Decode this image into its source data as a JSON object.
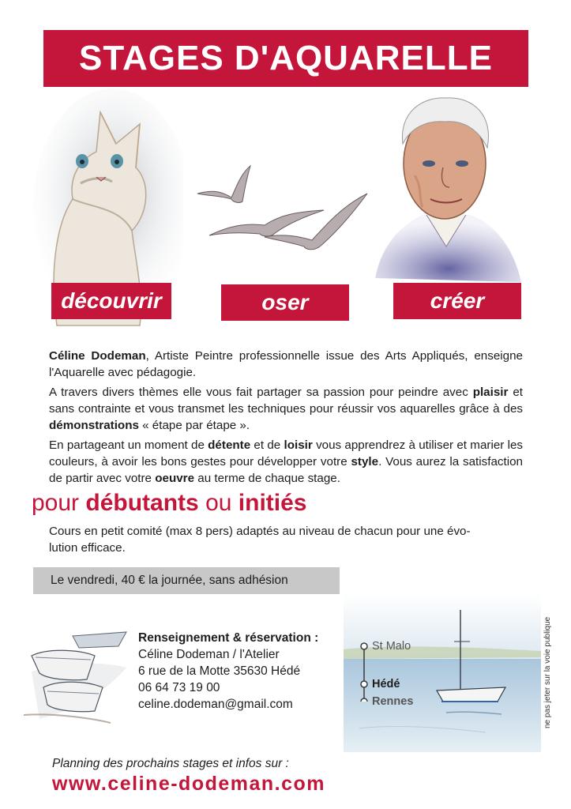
{
  "colors": {
    "brand_red": "#c4153a",
    "price_bar": "#c8c8c8"
  },
  "banner": {
    "title": "STAGES D'AQUARELLE"
  },
  "illustrations": {
    "cat": "cat-watercolor",
    "birds": "seagulls-watercolor",
    "portrait": "man-portrait-watercolor",
    "boats": "rowboats-watercolor",
    "harbor": "sailboat-harbor-watercolor"
  },
  "tags": {
    "discover": "découvrir",
    "dare": "oser",
    "create": "créer"
  },
  "intro": {
    "p1": [
      {
        "t": "Céline Dodeman",
        "b": true
      },
      {
        "t": ", Artiste Peintre professionnelle issue des Arts Appliqués, enseigne l'Aquarelle avec pédagogie.",
        "b": false
      }
    ],
    "p2": [
      {
        "t": "A travers divers thèmes elle vous fait partager sa passion pour peindre avec ",
        "b": false
      },
      {
        "t": "plaisir",
        "b": true
      },
      {
        "t": " et sans contrainte et vous transmet les techniques pour réussir vos aquarelles grâce à des ",
        "b": false
      },
      {
        "t": "démonstrations",
        "b": true
      },
      {
        "t": " « étape par étape ».",
        "b": false
      }
    ],
    "p3": [
      {
        "t": "En partageant un moment de ",
        "b": false
      },
      {
        "t": "détente",
        "b": true
      },
      {
        "t": " et de ",
        "b": false
      },
      {
        "t": "loisir",
        "b": true
      },
      {
        "t": " vous apprendrez à utiliser et marier les couleurs, à avoir les bons gestes pour développer votre ",
        "b": false
      },
      {
        "t": "style",
        "b": true
      },
      {
        "t": ". Vous aurez la satisfaction de partir avec votre ",
        "b": false
      },
      {
        "t": "oeuvre",
        "b": true
      },
      {
        "t": " au terme de chaque stage.",
        "b": false
      }
    ]
  },
  "level": {
    "pour": "pour ",
    "beginners": "débutants",
    "ou": " ou ",
    "initiated": "initiés"
  },
  "course": {
    "line1": "Cours en petit comité (max 8 pers) adaptés au niveau de chacun pour une évo-",
    "line2": "lution efficace."
  },
  "price": {
    "text": "Le vendredi, 40 € la journée, sans adhésion"
  },
  "contact": {
    "heading": "Renseignement & réservation :",
    "name": "Céline Dodeman / l'Atelier",
    "address": "6 rue de la Motte  35630 Hédé",
    "phone": "06 64 73 19 00",
    "email": "celine.dodeman@gmail.com"
  },
  "route": {
    "stop1": "St Malo",
    "stop2": "Hédé",
    "stop3": "Rennes"
  },
  "footer": {
    "note": "ne pas jeter sur la voie publique",
    "planning": "Planning des prochains stages et infos sur :",
    "website": "www.celine-dodeman.com"
  }
}
